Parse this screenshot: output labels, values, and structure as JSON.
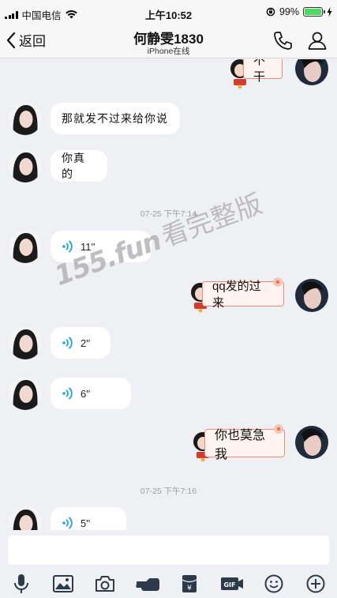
{
  "status_bar": {
    "carrier": "中国电信",
    "time": "上午10:52",
    "battery": "99%",
    "battery_level": 0.99
  },
  "nav": {
    "back_label": "返回",
    "title": "何静雯1830",
    "subtitle": "iPhone在线"
  },
  "messages": [
    {
      "side": "right",
      "type": "text",
      "text": "不干"
    },
    {
      "side": "left",
      "type": "text",
      "text": "那就发不过来给你说"
    },
    {
      "side": "left",
      "type": "text",
      "text": "你真的"
    },
    {
      "type": "time",
      "text": "07-25 下午7:14"
    },
    {
      "side": "left",
      "type": "voice",
      "text": "11''"
    },
    {
      "side": "right",
      "type": "text",
      "text": "qq发的过来"
    },
    {
      "side": "left",
      "type": "voice",
      "text": "2''"
    },
    {
      "side": "left",
      "type": "voice",
      "text": "6''"
    },
    {
      "side": "right",
      "type": "text",
      "text": "你也莫急我"
    },
    {
      "type": "time",
      "text": "07-25 下午7:16"
    },
    {
      "side": "left",
      "type": "voice",
      "text": "5''"
    }
  ],
  "watermark": {
    "url": "155.fun",
    "text": "看完整版"
  },
  "input": {
    "placeholder": ""
  },
  "toolbar": {
    "icons": [
      "microphone-icon",
      "image-icon",
      "camera-icon",
      "hongbao-finger-icon",
      "red-packet-icon",
      "gif-icon",
      "emoji-icon",
      "plus-icon"
    ],
    "gif_label": "GIF",
    "yuan_label": "¥"
  },
  "colors": {
    "accent_voice": "#1aa3e8",
    "bubble_right_border": "#f08a74",
    "battery": "#4cd964"
  }
}
